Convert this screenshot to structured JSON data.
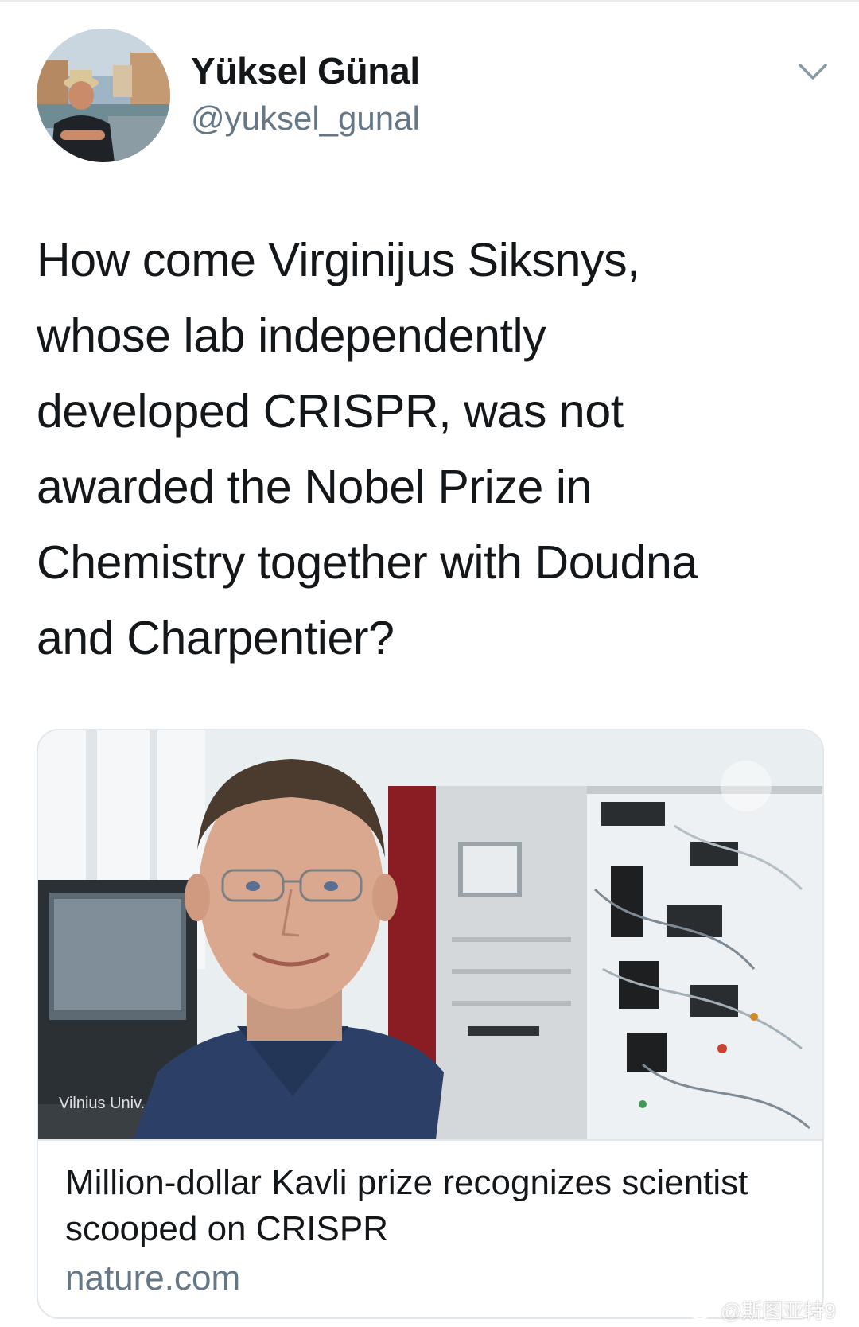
{
  "tweet": {
    "author_name": "Yüksel Günal",
    "author_handle": "@yuksel_gunal",
    "text": "How come Virginijus Siksnys,\nwhose lab independently\ndeveloped CRISPR, was not\nawarded the Nobel Prize in\nChemistry together with Doudna\nand Charpentier?",
    "menu_icon": "chevron-down-icon"
  },
  "card": {
    "image_credit": "Vilnius Univ.",
    "title": "Million-dollar Kavli prize recognizes scientist scooped on CRISPR",
    "domain": "nature.com"
  },
  "watermark": {
    "text": "@斯图亚特9",
    "icon": "weibo-logo-icon"
  },
  "colors": {
    "text_primary": "#14171a",
    "text_secondary": "#657786",
    "border": "#e1e8ed"
  }
}
